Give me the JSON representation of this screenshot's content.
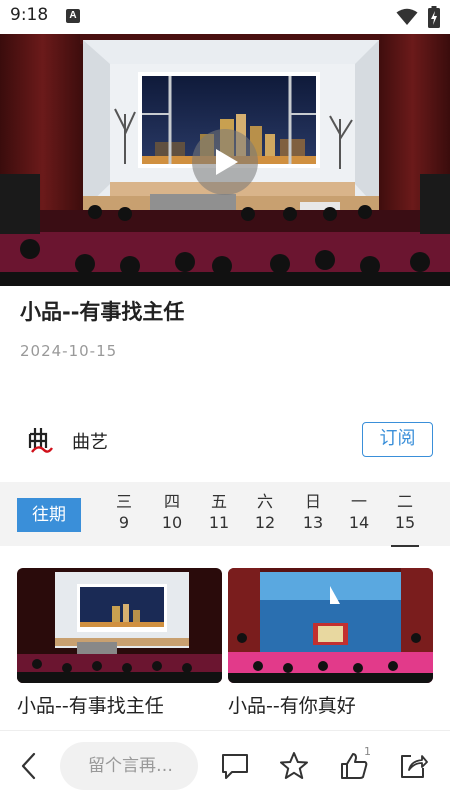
{
  "status_bar": {
    "time": "9:18",
    "notification_icon": "a-square-icon",
    "wifi_icon": "wifi-icon",
    "battery_icon": "battery-charging-icon"
  },
  "video": {
    "play_icon": "play-icon"
  },
  "detail": {
    "title": "小品--有事找主任",
    "date": "2024-10-15"
  },
  "channel": {
    "name": "曲艺",
    "subscribe_label": "订阅"
  },
  "date_strip": {
    "past_label": "往期",
    "days": [
      {
        "weekday": "三",
        "day": "9"
      },
      {
        "weekday": "四",
        "day": "10"
      },
      {
        "weekday": "五",
        "day": "11"
      },
      {
        "weekday": "六",
        "day": "12"
      },
      {
        "weekday": "日",
        "day": "13"
      },
      {
        "weekday": "一",
        "day": "14"
      },
      {
        "weekday": "二",
        "day": "15"
      }
    ],
    "selected_day": "15"
  },
  "grid": {
    "items": [
      {
        "title": "小品--有事找主任"
      },
      {
        "title": "小品--有你真好"
      }
    ]
  },
  "bottom_bar": {
    "comment_placeholder": "留个言再…",
    "like_count": "1"
  },
  "colors": {
    "accent": "#3a8fd9",
    "stage_curtain": "#6b1a1a",
    "carpet": "#7a1530"
  }
}
